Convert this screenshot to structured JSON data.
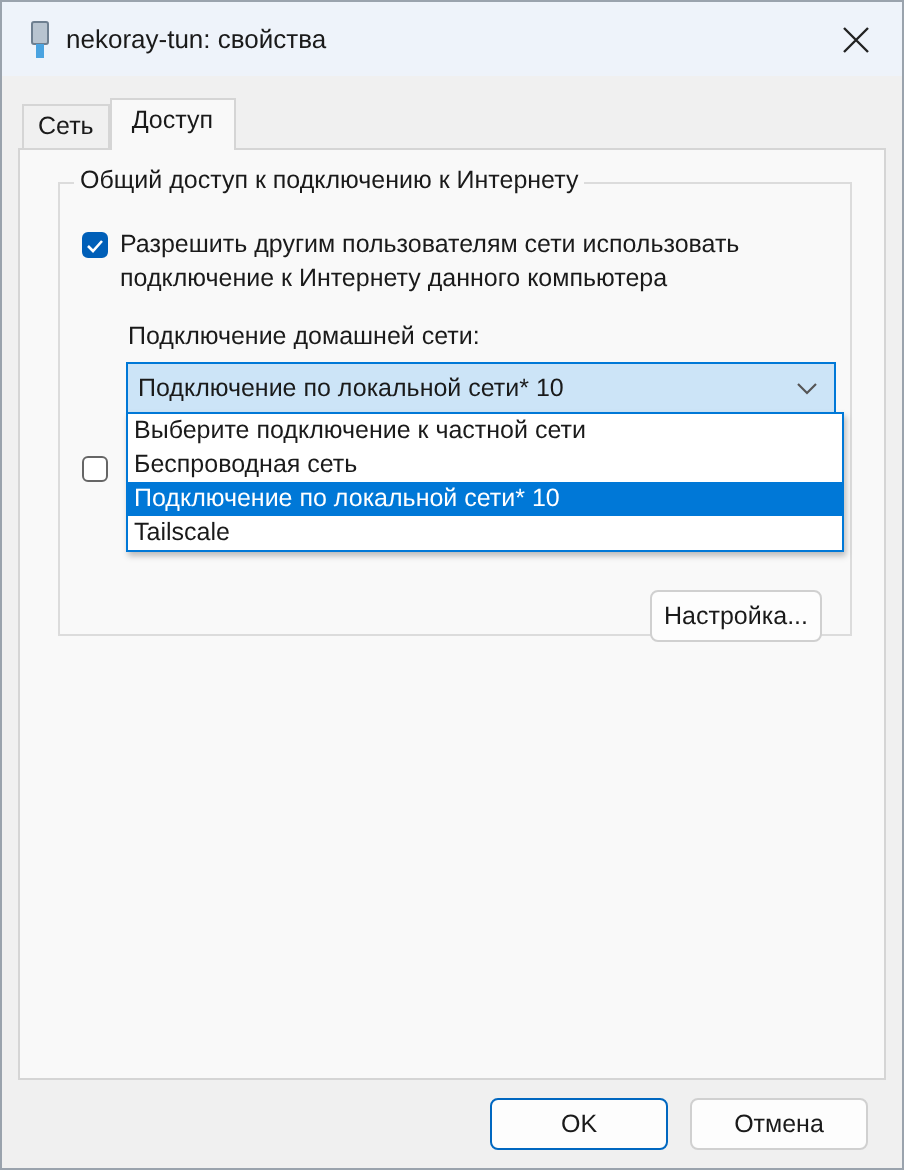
{
  "window": {
    "title": "nekoray-tun: свойства"
  },
  "tabs": [
    {
      "label": "Сеть",
      "selected": false
    },
    {
      "label": "Доступ",
      "selected": true
    }
  ],
  "group": {
    "title": "Общий доступ к подключению к Интернету",
    "allow_sharing": {
      "label": "Разрешить другим пользователям сети использовать подключение к Интернету данного компьютера",
      "checked": true
    },
    "home_network": {
      "label": "Подключение домашней сети:",
      "value": "Подключение по локальной сети* 10",
      "expanded": true,
      "options": [
        {
          "label": "Выберите подключение к частной сети",
          "selected": false
        },
        {
          "label": "Беспроводная сеть",
          "selected": false
        },
        {
          "label": "Подключение по локальной сети* 10",
          "selected": true
        },
        {
          "label": "Tailscale",
          "selected": false
        }
      ]
    },
    "allow_control": {
      "checked": false
    },
    "settings_button": "Настройка..."
  },
  "buttons": [
    {
      "label": "OK",
      "default": true
    },
    {
      "label": "Отмена",
      "default": false
    }
  ]
}
